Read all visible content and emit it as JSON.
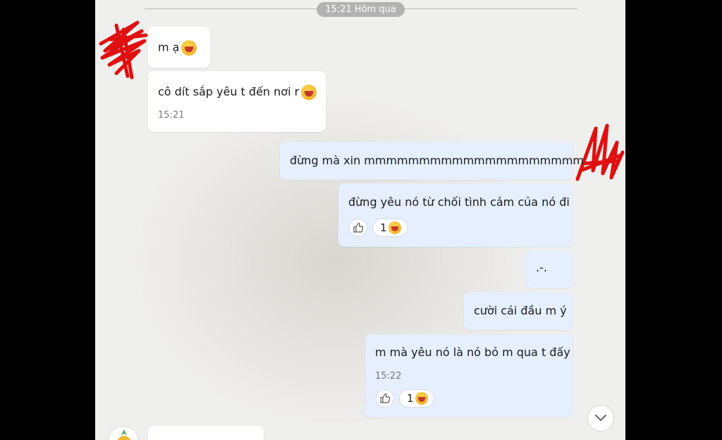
{
  "chat": {
    "date_separator": "15:21 Hôm qua",
    "messages": [
      {
        "side": "in",
        "text": "m ạ",
        "emoji": "laughing-emoji"
      },
      {
        "side": "in",
        "text": "cô dít sắp yêu t đến nơi r",
        "emoji": "laughing-emoji",
        "time": "15:21"
      },
      {
        "side": "out",
        "text": "đừng mà xin mmmmmmmmmmmmmmmmmmmm"
      },
      {
        "side": "out",
        "text": "đừng yêu nó từ chối tình cảm của nó đi",
        "reaction": {
          "count": "1",
          "emoji": "laughing-emoji"
        }
      },
      {
        "side": "out",
        "text": ".-."
      },
      {
        "side": "out",
        "text": "cười cái đầu m ý"
      },
      {
        "side": "out",
        "text": "m mà yêu nó là nó bỏ m qua t đấy",
        "time": "15:22",
        "reaction": {
          "count": "1",
          "emoji": "laughing-emoji"
        }
      },
      {
        "side": "in",
        "text": "",
        "partial": true
      }
    ]
  },
  "icons": {
    "like": "thumbs-up-icon",
    "scroll_down": "chevron-down-icon",
    "reaction": "laughing-emoji"
  },
  "colors": {
    "incoming_bubble": "#ffffff",
    "outgoing_bubble": "#e5efff",
    "scribble": "#e01010",
    "chat_background": "#efefed",
    "time_pill": "#b3b3b3"
  }
}
